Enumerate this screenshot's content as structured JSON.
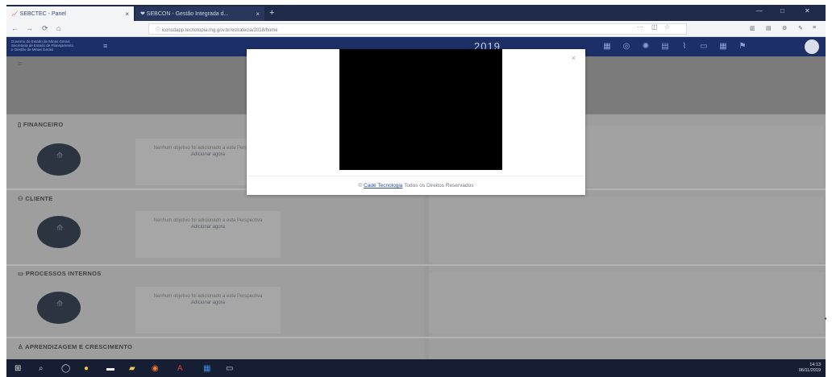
{
  "browser": {
    "tabs": [
      {
        "label": "📈 SEBCTEC - Panel"
      },
      {
        "label": "❤ SEBCON - Gestão Integrada d..."
      }
    ],
    "address": "ⓘ  iconsdapp.tecnotopia.mg.gov.br/estratecia/2018/home",
    "controls": {
      "minimize": "—",
      "maximize": "□",
      "close": "✕",
      "new_tab": "+"
    }
  },
  "app": {
    "brand_lines": [
      "Governo do Estado de Minas Gerais",
      "Secretaria de Estado de Planejamento",
      "e Gestão de Minas Gerais"
    ],
    "year": "2019"
  },
  "sections": [
    {
      "title": "FINANCEIRO",
      "empty_text": "Nenhum objetivo foi adicionado a esta Perspectiva",
      "link": "Adicionar agora"
    },
    {
      "title": "CLIENTE",
      "empty_text": "Nenhum objetivo foi adicionado a esta Perspectiva",
      "link": "Adicionar agora"
    },
    {
      "title": "PROCESSOS INTERNOS",
      "empty_text": "Nenhum objetivo foi adicionado a esta Perspectiva",
      "link": "Adicionar agora"
    },
    {
      "title": "APRENDIZAGEM E CRESCIMENTO"
    }
  ],
  "modal": {
    "close": "×",
    "footer_pre": "©",
    "company": "Cadé Tecnologia",
    "footer_post": "Todos os Direitos Reservados"
  },
  "taskbar": {
    "time": "14:13",
    "date": "06/11/2019"
  },
  "colors": {
    "header": "#1c2f66",
    "overlay": "#9e9e9e"
  }
}
